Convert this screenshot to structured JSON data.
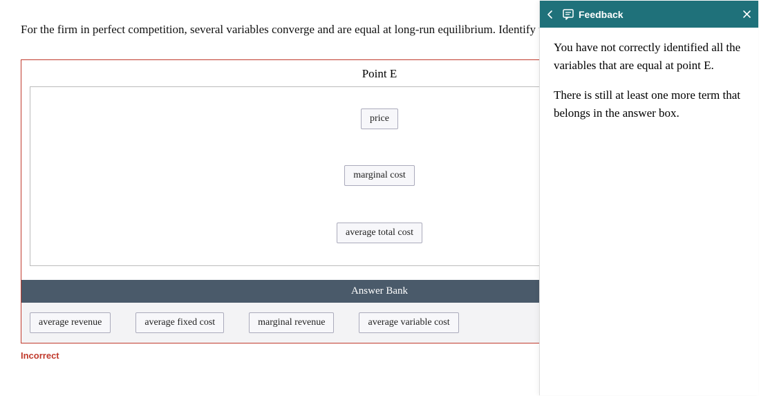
{
  "question": "For the firm in perfect competition, several variables converge and are equal at long-run equilibrium. Identify the variables that are equal at point E.",
  "activity": {
    "drop_title": "Point E",
    "dropped": [
      "price",
      "marginal cost",
      "average total cost"
    ],
    "bank_title": "Answer Bank",
    "bank_items": [
      "average revenue",
      "average fixed cost",
      "marginal revenue",
      "average variable cost"
    ]
  },
  "status": "Incorrect",
  "feedback": {
    "title": "Feedback",
    "p1": "You have not correctly identified all the variables that are equal at point E.",
    "p2": "There is still at least one more term that belongs in the answer box."
  }
}
